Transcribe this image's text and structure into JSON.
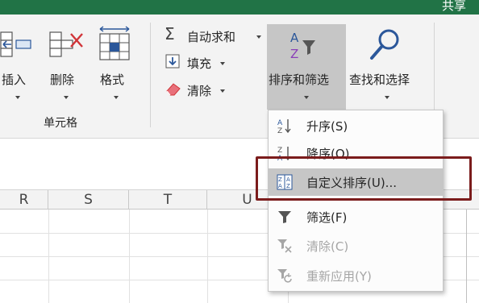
{
  "titlebar": {
    "share_label": "共享"
  },
  "ribbon": {
    "cells_group": {
      "insert_label": "插入",
      "delete_label": "删除",
      "format_label": "格式",
      "group_label": "单元格"
    },
    "editing_group": {
      "autosum_label": "自动求和",
      "fill_label": "填充",
      "clear_label": "清除",
      "sort_filter_label": "排序和筛选",
      "find_select_label": "查找和选择"
    }
  },
  "grid": {
    "columns": [
      "R",
      "S",
      "T",
      "U"
    ]
  },
  "sort_menu": {
    "items": [
      {
        "label": "升序(S)",
        "icon": "sort-ascending-icon",
        "enabled": true
      },
      {
        "label": "降序(O)",
        "icon": "sort-descending-icon",
        "enabled": true
      },
      {
        "label": "自定义排序(U)...",
        "icon": "custom-sort-icon",
        "enabled": true,
        "highlighted": true
      },
      {
        "label": "筛选(F)",
        "icon": "filter-icon",
        "enabled": true
      },
      {
        "label": "清除(C)",
        "icon": "clear-filter-icon",
        "enabled": false
      },
      {
        "label": "重新应用(Y)",
        "icon": "reapply-icon",
        "enabled": false
      }
    ]
  },
  "colors": {
    "titlebar": "#217346",
    "ribbon_bg": "#f3f3f3",
    "highlight": "#c6c6c6",
    "callout_border": "#7b1c1c",
    "icon_blue": "#2b579a",
    "icon_red": "#d13438"
  }
}
